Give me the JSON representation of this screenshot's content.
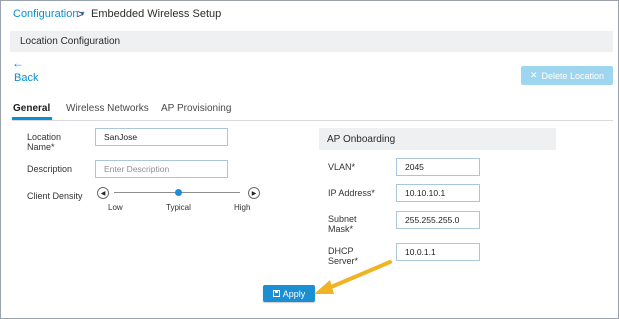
{
  "breadcrumb": {
    "parent": "Configuration",
    "caret": "▾",
    "separator": ">",
    "current": "Embedded Wireless Setup"
  },
  "section": {
    "title": "Location Configuration"
  },
  "back": {
    "arrow": "←",
    "label": "Back"
  },
  "delete_button": {
    "icon": "✕",
    "label": "Delete Location"
  },
  "tabs": [
    {
      "label": "General",
      "active": true
    },
    {
      "label": "Wireless Networks",
      "active": false
    },
    {
      "label": "AP Provisioning",
      "active": false
    }
  ],
  "form": {
    "location_name": {
      "label_line1": "Location",
      "label_line2": "Name*",
      "value": "SanJose"
    },
    "description": {
      "label": "Description",
      "placeholder": "Enter Description"
    },
    "client_density": {
      "label": "Client Density",
      "left_arrow": "◀",
      "right_arrow": "▶",
      "ticks": [
        "Low",
        "Typical",
        "High"
      ],
      "selected": "Typical"
    }
  },
  "ap_onboarding": {
    "title": "AP Onboarding",
    "vlan": {
      "label": "VLAN*",
      "value": "2045"
    },
    "ip_address": {
      "label": "IP Address*",
      "value": "10.10.10.1"
    },
    "subnet_mask": {
      "label_line1": "Subnet",
      "label_line2": "Mask*",
      "value": "255.255.255.0"
    },
    "dhcp_server": {
      "label_line1": "DHCP",
      "label_line2": "Server*",
      "value": "10.0.1.1"
    }
  },
  "apply_button": {
    "icon": "💾",
    "label": "Apply"
  },
  "colors": {
    "accent": "#0b8fce",
    "apply_bg": "#1b8fd1",
    "delete_bg": "#9fd6ef",
    "annotation_arrow": "#f0b323"
  }
}
